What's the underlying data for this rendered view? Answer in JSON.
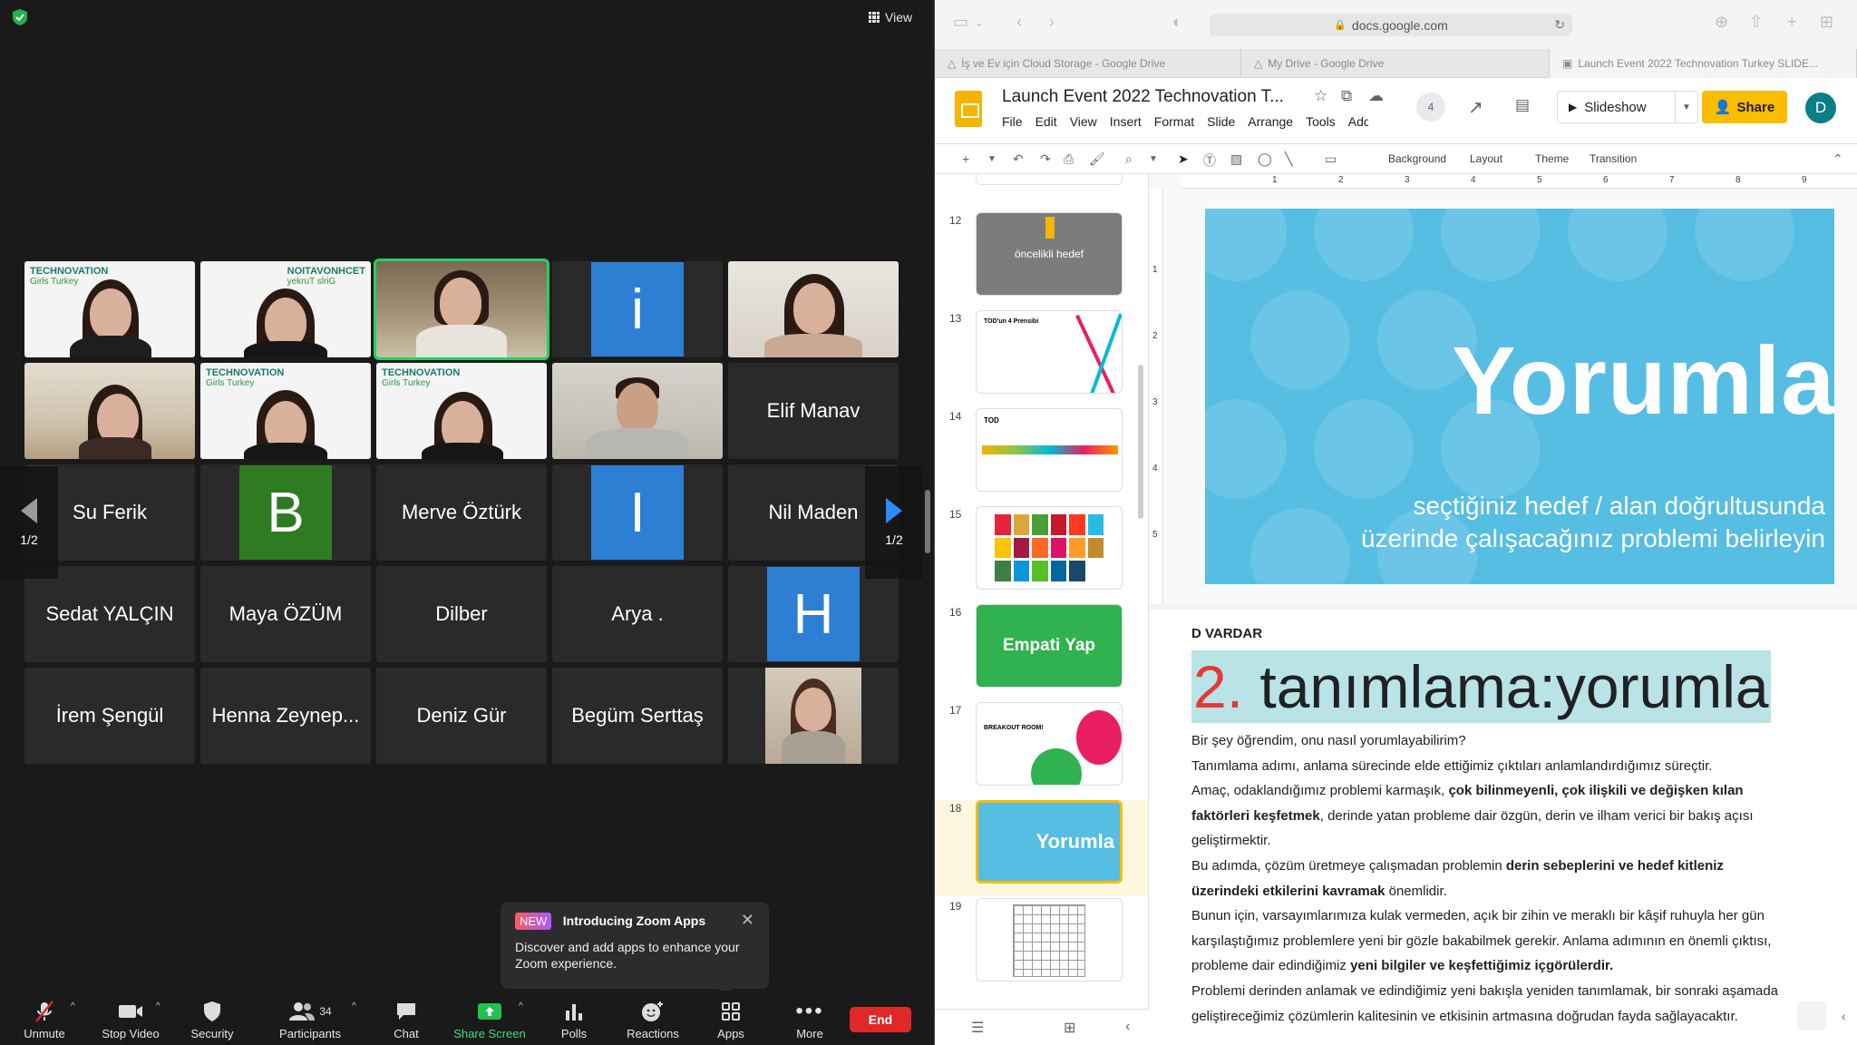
{
  "zoom": {
    "view_label": "View",
    "tiles": [
      {
        "kind": "video",
        "variant": "techno-girl-1"
      },
      {
        "kind": "video",
        "variant": "techno-girl-mirror"
      },
      {
        "kind": "video",
        "variant": "room-girl-glasses",
        "active": true
      },
      {
        "kind": "avatar",
        "letter": "i",
        "color": "#2d7fd3"
      },
      {
        "kind": "video",
        "variant": "girl-hand"
      },
      {
        "kind": "video",
        "variant": "classroom-girl"
      },
      {
        "kind": "video",
        "variant": "techno-girl-2"
      },
      {
        "kind": "video",
        "variant": "techno-girl-3"
      },
      {
        "kind": "video",
        "variant": "man-sweater"
      },
      {
        "kind": "name",
        "name": "Elif Manav"
      },
      {
        "kind": "name",
        "name": "Su Ferik"
      },
      {
        "kind": "avatar",
        "letter": "B",
        "color": "#2f7b22"
      },
      {
        "kind": "name",
        "name": "Merve Öztürk"
      },
      {
        "kind": "avatar",
        "letter": "I",
        "color": "#2d7fd3"
      },
      {
        "kind": "name",
        "name": "Nil Maden"
      },
      {
        "kind": "name",
        "name": "Sedat YALÇIN"
      },
      {
        "kind": "name",
        "name": "Maya ÖZÜM"
      },
      {
        "kind": "name",
        "name": "Dilber"
      },
      {
        "kind": "name",
        "name": "Arya ."
      },
      {
        "kind": "avatar",
        "letter": "H",
        "color": "#2d7fd3"
      },
      {
        "kind": "name",
        "name": "İrem Şengül"
      },
      {
        "kind": "name",
        "name": "Henna Zeynep..."
      },
      {
        "kind": "name",
        "name": "Deniz Gür"
      },
      {
        "kind": "name",
        "name": "Begüm Serttaş"
      },
      {
        "kind": "video",
        "variant": "girl-wall"
      }
    ],
    "page_left": "1/2",
    "page_right": "1/2",
    "apps_popup": {
      "badge": "NEW",
      "title": "Introducing Zoom Apps",
      "description": "Discover and add apps to enhance your Zoom experience."
    },
    "toolbar": {
      "unmute": "Unmute",
      "stop_video": "Stop Video",
      "security": "Security",
      "participants": "Participants",
      "participants_count": "34",
      "chat": "Chat",
      "share_screen": "Share Screen",
      "polls": "Polls",
      "reactions": "Reactions",
      "apps": "Apps",
      "more": "More",
      "end": "End"
    }
  },
  "browser": {
    "url": "docs.google.com",
    "tabs": [
      {
        "label": "İş ve Ev için Cloud Storage - Google Drive"
      },
      {
        "label": "My Drive - Google Drive"
      },
      {
        "label": "Launch Event 2022 Technovation Turkey SLIDE..."
      }
    ],
    "doc_title": "Launch Event 2022 Technovation T...",
    "menus": [
      "File",
      "Edit",
      "View",
      "Insert",
      "Format",
      "Slide",
      "Arrange",
      "Tools",
      "Add"
    ],
    "viewers_count": "4",
    "slideshow_label": "Slideshow",
    "share_label": "Share",
    "avatar_letter": "D",
    "toolbar_text": {
      "background": "Background",
      "layout": "Layout",
      "theme": "Theme",
      "transition": "Transition"
    },
    "thumbnails": [
      {
        "num": "12",
        "title": "öncelikli hedef"
      },
      {
        "num": "13",
        "title": "TOD'un 4 Prensibi"
      },
      {
        "num": "14",
        "title": "TOD"
      },
      {
        "num": "15",
        "title": ""
      },
      {
        "num": "16",
        "title": "Empati Yap"
      },
      {
        "num": "17",
        "title": "BREAKOUT ROOM!"
      },
      {
        "num": "18",
        "title": "Yorumla",
        "selected": true
      },
      {
        "num": "19",
        "title": ""
      }
    ],
    "slide": {
      "title": "Yorumla",
      "subtitle_line1": "seçtiğiniz hedef / alan doğrultusunda",
      "subtitle_line2": "üzerinde çalışacağınız problemi belirleyin",
      "background": "#56bde3"
    },
    "ruler_h": [
      "1",
      "2",
      "3",
      "4",
      "5",
      "6",
      "7",
      "8",
      "9"
    ],
    "ruler_v": [
      "1",
      "2",
      "3",
      "4",
      "5"
    ],
    "notes": {
      "author": "D VARDAR",
      "heading_num": "2.",
      "heading_text": " tanımlama:yorumla",
      "p1": "Bir şey öğrendim, onu nasıl yorumlayabilirim?",
      "p2": "Tanımlama adımı, anlama sürecinde elde ettiğimiz çıktıları anlamlandırdığımız süreçtir.",
      "p3a": "Amaç, odaklandığımız problemi karmaşık, ",
      "p3b": "çok bilinmeyenli, çok ilişkili ve değişken kılan faktörleri keşfetmek",
      "p3c": ", derinde yatan probleme dair özgün, derin ve ilham verici bir bakış açısı geliştirmektir.",
      "p4a": "Bu adımda, çözüm üretmeye çalışmadan problemin ",
      "p4b": "derin sebeplerini ve hedef kitleniz üzerindeki etkilerini kavramak",
      "p4c": " önemlidir.",
      "p5a": "Bunun için, varsayımlarımıza kulak vermeden, açık bir zihin ve meraklı bir kâşif ruhuyla her gün karşılaştığımız problemlere yeni bir gözle bakabilmek gerekir. Anlama adımının en önemli çıktısı, probleme dair edindiğimiz ",
      "p5b": "yeni bilgiler ve keşfettiğimiz içgörülerdir.",
      "p6": "Problemi derinden anlamak ve edindiğimiz yeni bakışla yeniden tanımlamak, bir sonraki aşamada geliştireceğimiz çözümlerin kalitesinin ve etkisinin artmasına doğrudan fayda sağlayacaktır."
    }
  }
}
